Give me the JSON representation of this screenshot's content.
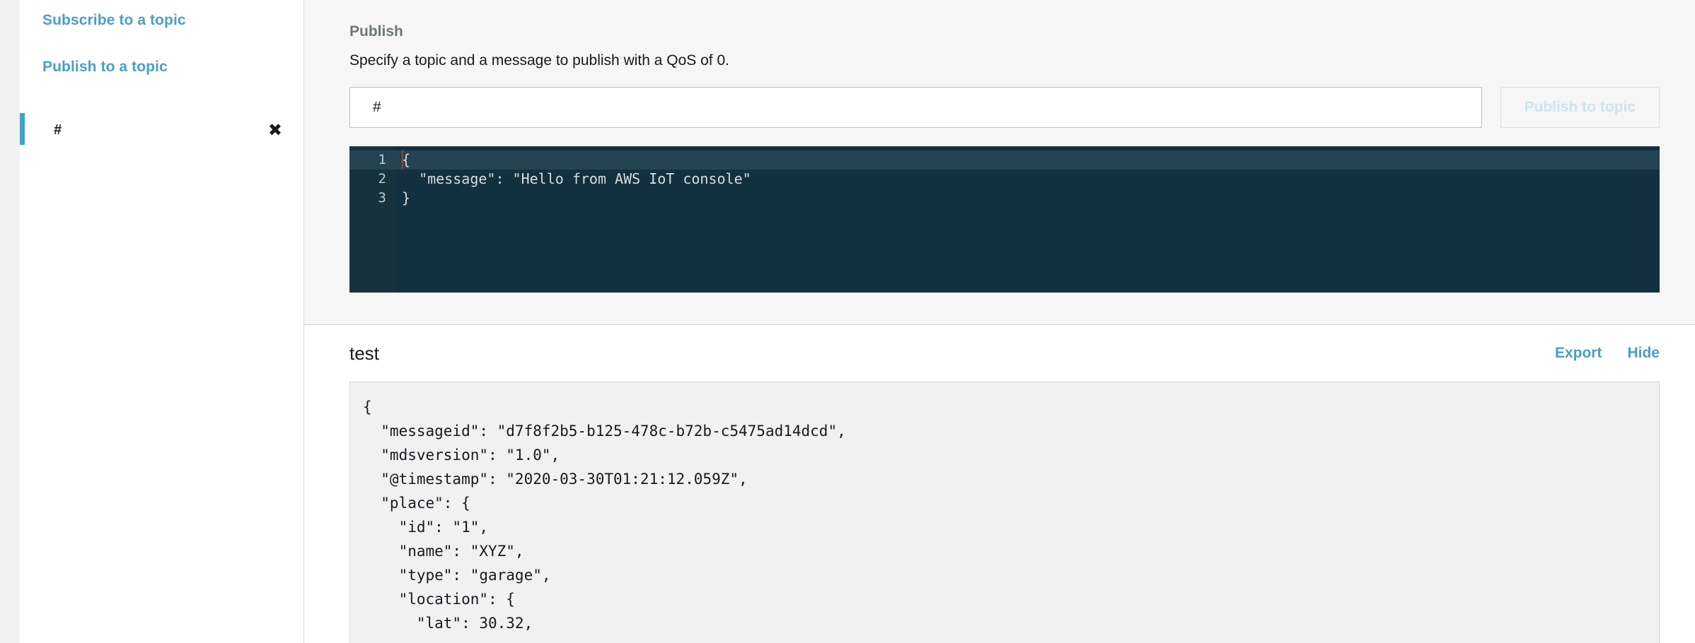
{
  "sidebar": {
    "links": [
      {
        "label": "Subscribe to a topic"
      },
      {
        "label": "Publish to a topic"
      }
    ],
    "subscriptions": [
      {
        "name": "#",
        "close_icon": "close-x-icon",
        "accent_color": "#44a0c7"
      }
    ]
  },
  "publish": {
    "title": "Publish",
    "description": "Specify a topic and a message to publish with a QoS of 0.",
    "topic_value": "#",
    "topic_placeholder": "",
    "button_label": "Publish to topic",
    "editor": {
      "lines": [
        "1",
        "2",
        "3"
      ],
      "content": [
        "{",
        "  \"message\": \"Hello from AWS IoT console\"",
        "}"
      ],
      "active_line": 1,
      "background": "#123040",
      "gutter_background": "#17323f"
    }
  },
  "results": {
    "title": "test",
    "actions": [
      {
        "label": "Export"
      },
      {
        "label": "Hide"
      }
    ],
    "payload": "{\n  \"messageid\": \"d7f8f2b5-b125-478c-b72b-c5475ad14dcd\",\n  \"mdsversion\": \"1.0\",\n  \"@timestamp\": \"2020-03-30T01:21:12.059Z\",\n  \"place\": {\n    \"id\": \"1\",\n    \"name\": \"XYZ\",\n    \"type\": \"garage\",\n    \"location\": {\n      \"lat\": 30.32,"
  },
  "colors": {
    "link_blue": "#4b9fc4",
    "accent_blue": "#44a0c7",
    "panel_bg": "#f6f6f6",
    "page_bg": "#f1f1f1"
  }
}
